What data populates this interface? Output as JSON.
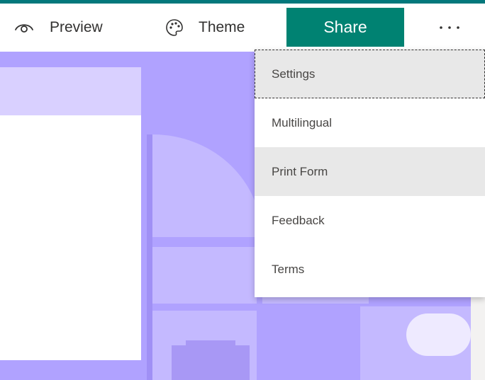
{
  "toolbar": {
    "preview_label": "Preview",
    "theme_label": "Theme",
    "share_label": "Share",
    "preview_icon": "eye-icon",
    "theme_icon": "palette-icon",
    "more_icon": "more-options-icon"
  },
  "menu": {
    "items": [
      {
        "label": "Settings",
        "state": "focused"
      },
      {
        "label": "Multilingual",
        "state": "normal"
      },
      {
        "label": "Print Form",
        "state": "hovered"
      },
      {
        "label": "Feedback",
        "state": "normal"
      },
      {
        "label": "Terms",
        "state": "normal"
      }
    ]
  },
  "colors": {
    "accent_bar": "#03787c",
    "share_button": "#008272",
    "theme_background": "#b0a2ff",
    "menu_highlight": "#e8e8e8"
  }
}
